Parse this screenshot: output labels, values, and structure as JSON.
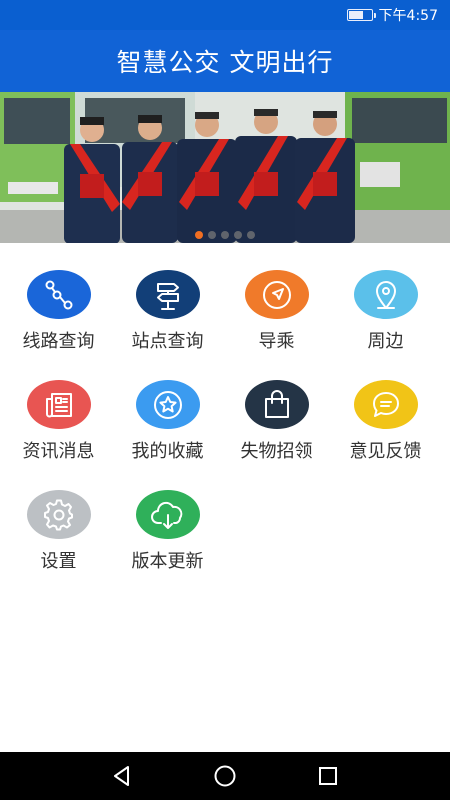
{
  "status_bar": {
    "time": "下午4:57",
    "battery_level": 0.7
  },
  "header": {
    "title": "智慧公交 文明出行"
  },
  "banner": {
    "slide_count": 5,
    "active_index": 0
  },
  "menu": [
    {
      "label": "线路查询",
      "icon": "route-icon",
      "color": "#1a66d9"
    },
    {
      "label": "站点查询",
      "icon": "signpost-icon",
      "color": "#123f78"
    },
    {
      "label": "导乘",
      "icon": "compass-icon",
      "color": "#f07a2a"
    },
    {
      "label": "周边",
      "icon": "location-pin-icon",
      "color": "#5bc0ea"
    },
    {
      "label": "资讯消息",
      "icon": "news-icon",
      "color": "#e85552"
    },
    {
      "label": "我的收藏",
      "icon": "star-icon",
      "color": "#3b9bf0"
    },
    {
      "label": "失物招领",
      "icon": "bag-icon",
      "color": "#243446"
    },
    {
      "label": "意见反馈",
      "icon": "chat-icon",
      "color": "#f1c417"
    },
    {
      "label": "设置",
      "icon": "gear-icon",
      "color": "#bcc0c4"
    },
    {
      "label": "版本更新",
      "icon": "cloud-download-icon",
      "color": "#2fb05a"
    }
  ]
}
